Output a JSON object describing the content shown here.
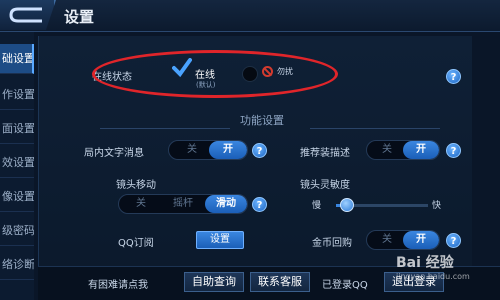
{
  "header": {
    "title": "设置"
  },
  "sidebar": {
    "items": [
      {
        "label": "础设置",
        "active": true
      },
      {
        "label": "作设置",
        "active": false
      },
      {
        "label": "面设置",
        "active": false
      },
      {
        "label": "效设置",
        "active": false
      },
      {
        "label": "像设置",
        "active": false
      },
      {
        "label": "级密码",
        "active": false
      },
      {
        "label": "络诊断",
        "active": false
      }
    ]
  },
  "online_status": {
    "label": "在线状态",
    "option_online": "在线",
    "option_online_note": "(默认)",
    "option_dnd": "勿扰",
    "selected": "在线"
  },
  "section": {
    "title": "功能设置"
  },
  "settings": {
    "in_game_text": {
      "label": "局内文字消息",
      "off": "关",
      "on": "开",
      "value": "开"
    },
    "recommended_gear": {
      "label": "推荐装描述",
      "off": "关",
      "on": "开",
      "value": "开"
    },
    "camera_move": {
      "label": "镜头移动",
      "options": [
        "关",
        "摇杆",
        "滑动"
      ],
      "value": "滑动"
    },
    "camera_sensitivity": {
      "label": "镜头灵敏度",
      "slow": "慢",
      "fast": "快",
      "value": 0.12
    },
    "qq_subscribe": {
      "label": "QQ订阅",
      "button": "设置"
    },
    "coin_return": {
      "label": "金币回购",
      "off": "关",
      "on": "开",
      "value": "开"
    }
  },
  "bottom": {
    "help_text": "有困难请点我",
    "auto_query": "自助查询",
    "contact": "联系客服",
    "logged_in": "已登录QQ",
    "logout": "退出登录"
  },
  "watermark": {
    "text": "Bai 经验",
    "sub": "jingyan.baidu.com"
  },
  "colors": {
    "accent": "#1b5fb8",
    "ring": "#e0252a",
    "background": "#0a1628"
  }
}
